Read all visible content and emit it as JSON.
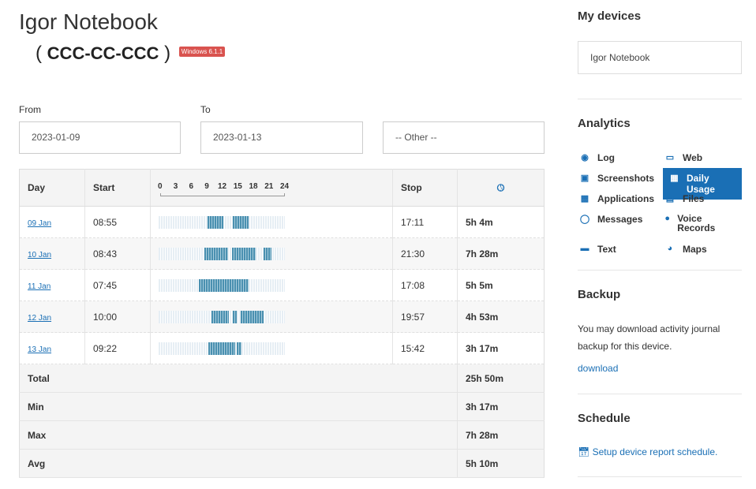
{
  "header": {
    "device_name": "Igor Notebook",
    "device_code": "CCC-CC-CCC",
    "open_paren": "(",
    "close_paren": ")",
    "os_badge": "Windows 6.1.1"
  },
  "filters": {
    "from_label": "From",
    "from_value": "2023-01-09",
    "to_label": "To",
    "to_value": "2023-01-13",
    "other_value": "-- Other --"
  },
  "table": {
    "headers": {
      "day": "Day",
      "start": "Start",
      "stop": "Stop",
      "duration_icon": "clock-icon"
    },
    "scale_ticks": [
      "0",
      "3",
      "6",
      "9",
      "12",
      "15",
      "18",
      "21",
      "24"
    ],
    "rows": [
      {
        "day": "09 Jan",
        "start": "08:55",
        "stop": "17:11",
        "duration": "5h 4m",
        "active_ranges": [
          [
            9.3,
            12.3
          ],
          [
            14.1,
            17.1
          ]
        ]
      },
      {
        "day": "10 Jan",
        "start": "08:43",
        "stop": "21:30",
        "duration": "7h 28m",
        "active_ranges": [
          [
            8.7,
            13.2
          ],
          [
            14.0,
            18.4
          ],
          [
            19.9,
            21.5
          ]
        ]
      },
      {
        "day": "11 Jan",
        "start": "07:45",
        "stop": "17:08",
        "duration": "5h 5m",
        "active_ranges": [
          [
            7.7,
            17.1
          ]
        ]
      },
      {
        "day": "12 Jan",
        "start": "10:00",
        "stop": "19:57",
        "duration": "4h 53m",
        "active_ranges": [
          [
            10.0,
            13.4
          ],
          [
            14.1,
            14.9
          ],
          [
            15.6,
            19.9
          ]
        ]
      },
      {
        "day": "13 Jan",
        "start": "09:22",
        "stop": "15:42",
        "duration": "3h 17m",
        "active_ranges": [
          [
            9.4,
            14.6
          ],
          [
            14.9,
            15.7
          ]
        ]
      }
    ],
    "summary": [
      {
        "label": "Total",
        "value": "25h 50m"
      },
      {
        "label": "Min",
        "value": "3h 17m"
      },
      {
        "label": "Max",
        "value": "7h 28m"
      },
      {
        "label": "Avg",
        "value": "5h 10m"
      }
    ]
  },
  "sidebar": {
    "devices_title": "My devices",
    "selected_device": "Igor Notebook",
    "analytics_title": "Analytics",
    "analytics_items": [
      {
        "label": "Log",
        "icon": "eye-icon"
      },
      {
        "label": "Web",
        "icon": "monitor-icon"
      },
      {
        "label": "Screenshots",
        "icon": "camera-icon"
      },
      {
        "label": "Daily Usage",
        "icon": "calendar-icon",
        "active": true
      },
      {
        "label": "Applications",
        "icon": "apps-icon"
      },
      {
        "label": "Files",
        "icon": "files-icon"
      },
      {
        "label": "Messages",
        "icon": "chat-icon"
      },
      {
        "label": "Voice Records",
        "icon": "microphone-icon"
      },
      {
        "label": "Text",
        "icon": "keyboard-icon"
      },
      {
        "label": "Maps",
        "icon": "globe-icon"
      }
    ],
    "backup_title": "Backup",
    "backup_text": "You may download activity journal backup for this device.",
    "backup_link": "download",
    "schedule_title": "Schedule",
    "schedule_link": "Setup device report schedule.",
    "accent_color": "#1a6fb5"
  }
}
